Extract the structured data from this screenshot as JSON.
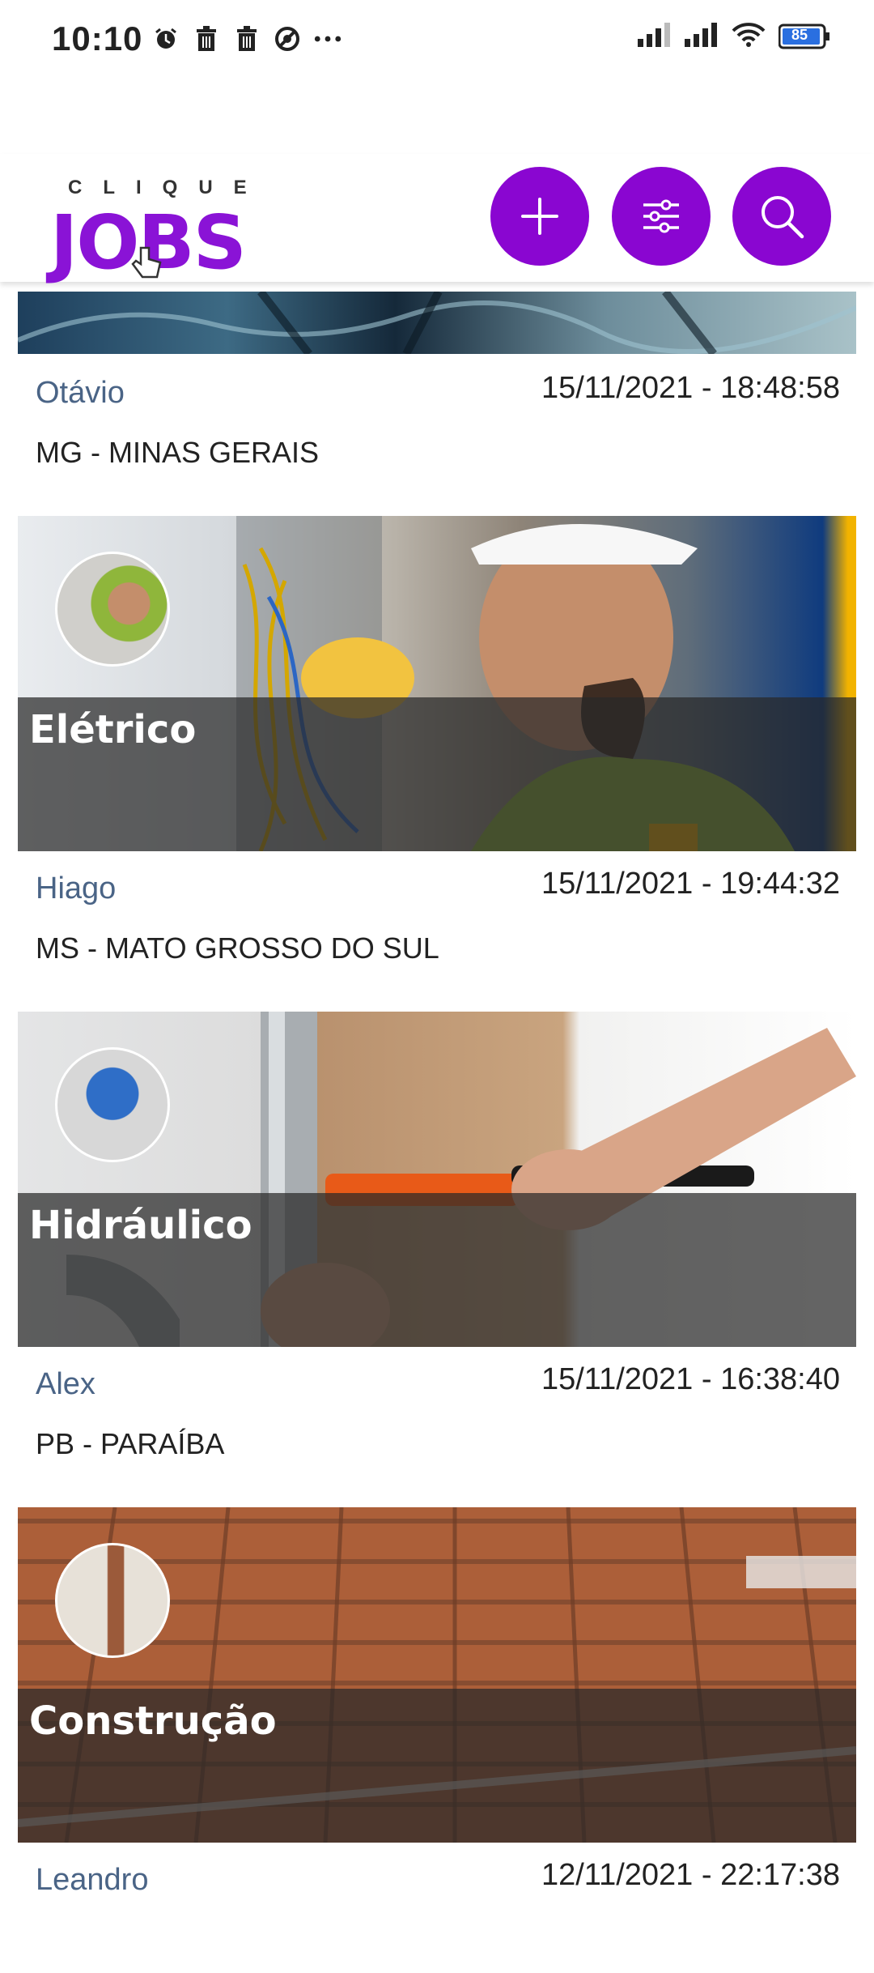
{
  "status_bar": {
    "time": "10:10",
    "left_icons": [
      "alarm-icon",
      "trash-icon",
      "trash-icon",
      "do-not-disturb-icon",
      "more-icon"
    ],
    "right_icons": [
      "signal-icon",
      "signal-icon",
      "wifi-icon",
      "battery-icon"
    ],
    "battery": "85"
  },
  "header": {
    "logo_small": "CLIQUE",
    "logo_big": "JOBS",
    "buttons": [
      "add-icon",
      "filter-icon",
      "search-icon"
    ]
  },
  "accent_color": "#8a06d1",
  "listings": [
    {
      "name": "Otávio",
      "datetime": "15/11/2021 - 18:48:58",
      "state": "MG - MINAS GERAIS"
    },
    {
      "category": "Elétrico",
      "name": "Hiago",
      "datetime": "15/11/2021 - 19:44:32",
      "state": "MS - MATO GROSSO DO SUL"
    },
    {
      "category": "Hidráulico",
      "name": "Alex",
      "datetime": "15/11/2021 - 16:38:40",
      "state": "PB - PARAÍBA"
    },
    {
      "category": "Construção",
      "name": "Leandro",
      "datetime": "12/11/2021 - 22:17:38"
    }
  ]
}
